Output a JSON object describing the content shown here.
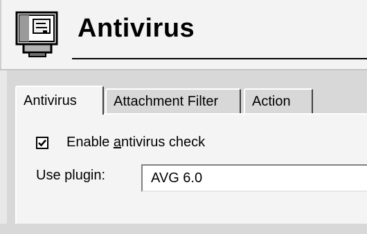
{
  "header": {
    "title": "Antivirus",
    "icon": "server-window-icon"
  },
  "tabs": [
    {
      "label": "Antivirus",
      "active": true
    },
    {
      "label": "Attachment Filter",
      "active": false
    },
    {
      "label": "Action",
      "active": false
    }
  ],
  "settings": {
    "enable_check": {
      "label_pre": "Enable ",
      "label_accel": "a",
      "label_post": "ntivirus check",
      "checked": true
    },
    "plugin": {
      "label": "Use plugin:",
      "value": "AVG 6.0"
    }
  }
}
